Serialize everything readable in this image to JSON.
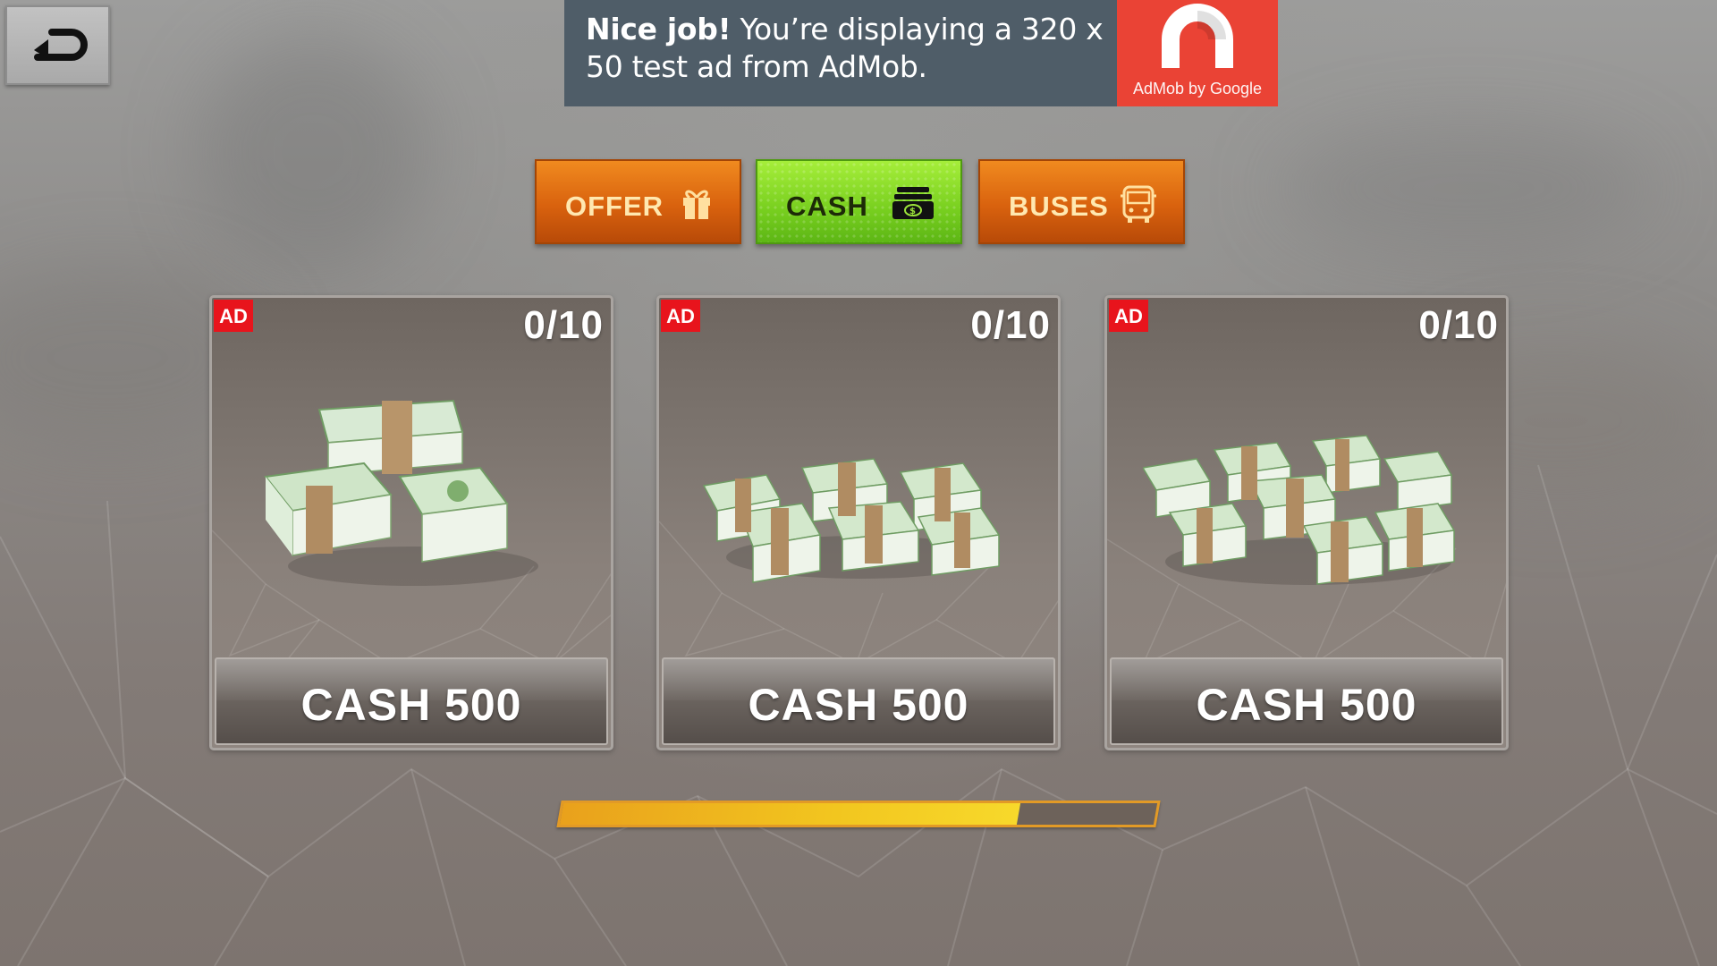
{
  "ad_banner": {
    "headline": "Nice job!",
    "body": " You’re displaying a 320 x 50 test ad from AdMob.",
    "logo_caption": "AdMob by Google",
    "brand_color": "#ea4335",
    "background_color": "#4f5d68"
  },
  "tabs": [
    {
      "label": "OFFER",
      "icon": "gift-icon",
      "active": false
    },
    {
      "label": "CASH",
      "icon": "cash-icon",
      "active": true
    },
    {
      "label": "BUSES",
      "icon": "bus-icon",
      "active": false
    }
  ],
  "cards": [
    {
      "badge": "AD",
      "counter": "0/10",
      "button_label": "CASH 500",
      "art": "small-cash-stack"
    },
    {
      "badge": "AD",
      "counter": "0/10",
      "button_label": "CASH 500",
      "art": "medium-cash-stack"
    },
    {
      "badge": "AD",
      "counter": "0/10",
      "button_label": "CASH 500",
      "art": "large-cash-pile"
    }
  ],
  "progress": {
    "fraction": 0.77
  },
  "colors": {
    "tab_active": "#78cf1f",
    "tab_inactive": "#d9620e",
    "ad_badge": "#e8141c",
    "progress_fill": "#f2c61f"
  },
  "icons": {
    "back": "back-arrow-icon"
  }
}
